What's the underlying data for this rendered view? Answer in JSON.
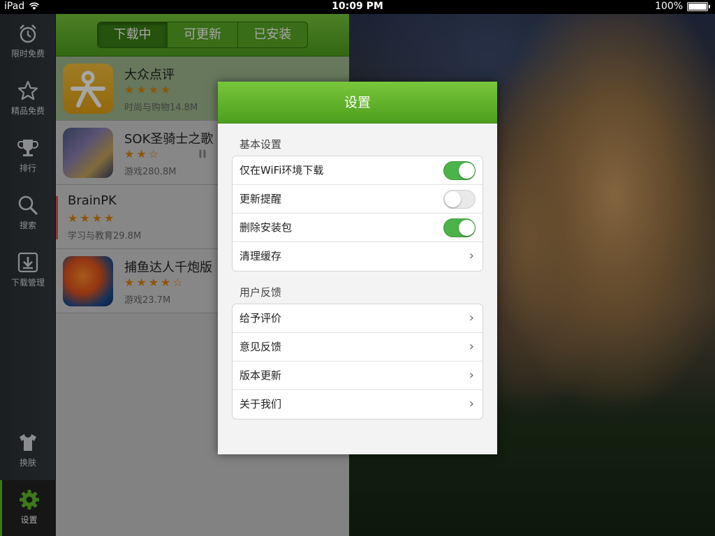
{
  "status_bar": {
    "device": "iPad",
    "time": "10:09 PM",
    "battery": "100%",
    "battery_level": 1.0
  },
  "sidebar": {
    "items": [
      {
        "label": "限时免费",
        "icon": "alarm-clock-icon"
      },
      {
        "label": "精品免费",
        "icon": "star-icon"
      },
      {
        "label": "排行",
        "icon": "trophy-icon"
      },
      {
        "label": "搜索",
        "icon": "search-icon"
      },
      {
        "label": "下载管理",
        "icon": "download-icon"
      },
      {
        "label": "换肤",
        "icon": "tshirt-icon"
      },
      {
        "label": "设置",
        "icon": "gear-icon",
        "active": true
      }
    ]
  },
  "tabs": [
    {
      "label": "下载中",
      "active": true
    },
    {
      "label": "可更新",
      "active": false
    },
    {
      "label": "已安装",
      "active": false
    }
  ],
  "apps": [
    {
      "name": "大众点评",
      "stars": "★★★★",
      "rating": 4,
      "meta": "时尚与购物14.8M"
    },
    {
      "name": "SOK圣骑士之歌",
      "stars": "★★☆",
      "rating": 2.5,
      "meta": "游戏280.8M",
      "pause": "II"
    },
    {
      "name": "BrainPK",
      "stars": "★★★★",
      "rating": 4,
      "meta": "学习与教育29.8M"
    },
    {
      "name": "捕鱼达人千炮版",
      "stars": "★★★★☆",
      "rating": 4.5,
      "meta": "游戏23.7M"
    }
  ],
  "settings": {
    "title": "设置",
    "basic_title": "基本设置",
    "basic": [
      {
        "label": "仅在WiFi环境下载",
        "type": "toggle",
        "on": true
      },
      {
        "label": "更新提醒",
        "type": "toggle",
        "on": false
      },
      {
        "label": "删除安装包",
        "type": "toggle",
        "on": true
      },
      {
        "label": "清理缓存",
        "type": "link"
      }
    ],
    "feedback_title": "用户反馈",
    "feedback": [
      {
        "label": "给予评价"
      },
      {
        "label": "意见反馈"
      },
      {
        "label": "版本更新"
      },
      {
        "label": "关于我们"
      }
    ]
  },
  "colors": {
    "accent": "#5dba2a",
    "toggle_on": "#4cb34a",
    "star": "#d9850f"
  }
}
